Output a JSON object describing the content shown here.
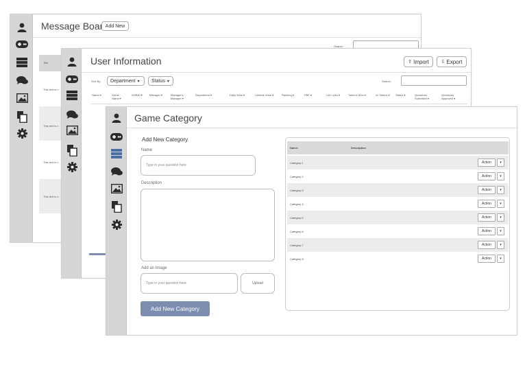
{
  "message_board": {
    "title": "Message Board",
    "add_new_label": "Add New",
    "search_label": "Search:",
    "table_header": "Title",
    "rows": [
      "This text is n",
      "This text is n",
      "This text is n",
      "This text is n"
    ]
  },
  "user_info": {
    "title": "User Information",
    "import_label": "Import",
    "export_label": "Export",
    "sort_by_label": "Sort By:",
    "department_select": "Department",
    "status_select": "Status",
    "search_label": "Search:",
    "columns": [
      "Name ▾",
      "Game Name ▾",
      "DOBID ▾",
      "Manager ▾",
      "Manager's Manager ▾",
      "Department ▾",
      "Daily Wins ▾",
      "Lifetime Wins ▾",
      "Ranking ▾",
      "PBF ▾",
      "Life Lives ▾",
      "Token's Won ▾",
      "AI Tokens ▾",
      "Status ▾",
      "Questions Submitted ▾",
      "Questions Approved ▾"
    ]
  },
  "game_category": {
    "title": "Game Category",
    "form_heading": "Add New Category",
    "name_label": "Name",
    "name_placeholder": "Type in your question here",
    "description_label": "Description",
    "image_label": "Add an Image",
    "image_placeholder": "Type in your question here",
    "upload_label": "Upload",
    "submit_label": "Add New Category",
    "table_headers": {
      "name": "Name:",
      "description": "Description"
    },
    "categories": [
      "Category 1",
      "Category 2",
      "Category 3",
      "Category 4",
      "Category 5",
      "Category 6",
      "Category 7",
      "Category 8"
    ],
    "action_label": "Action",
    "action_caret": "▾"
  },
  "colors": {
    "sidebar": "#d6d6d6",
    "icon": "#2b2b2b",
    "blue_icon": "#4a6fa5",
    "primary_button": "#7d8db0",
    "table_stripe": "#ececec",
    "table_header": "#dadada"
  },
  "icons": [
    "user-icon",
    "gamepad-icon",
    "list-icon",
    "chat-icon",
    "image-icon",
    "documents-icon",
    "gear-icon"
  ]
}
